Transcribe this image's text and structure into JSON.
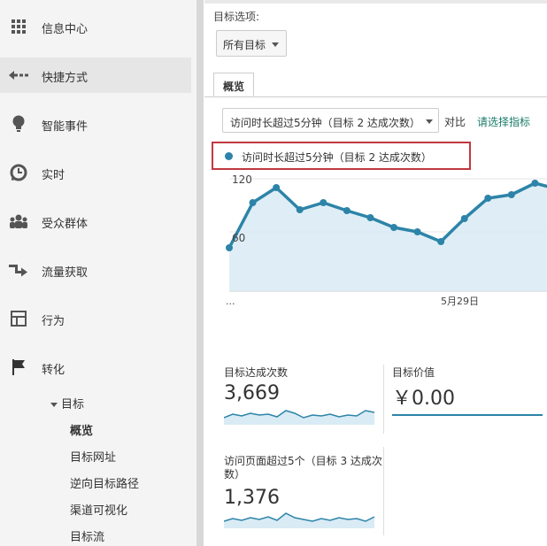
{
  "sidebar": {
    "items": [
      {
        "label": "信息中心",
        "icon": "grid-icon"
      },
      {
        "label": "快捷方式",
        "icon": "shortcut-arrow-icon"
      },
      {
        "label": "智能事件",
        "icon": "lightbulb-icon"
      },
      {
        "label": "实时",
        "icon": "clock-icon"
      },
      {
        "label": "受众群体",
        "icon": "people-icon"
      },
      {
        "label": "流量获取",
        "icon": "acquisition-icon"
      },
      {
        "label": "行为",
        "icon": "behavior-icon"
      },
      {
        "label": "转化",
        "icon": "flag-icon"
      }
    ],
    "sub_group_label": "目标",
    "sub_items": [
      "概览",
      "目标网址",
      "逆向目标路径",
      "渠道可视化",
      "目标流"
    ]
  },
  "main": {
    "goal_option_label": "目标选项:",
    "goal_select_value": "所有目标",
    "tab_overview": "概览",
    "metric_select_value": "访问时长超过5分钟（目标 2 达成次数）",
    "compare_label": "对比",
    "choose_metric_link": "请选择指标",
    "legend_label": "访问时长超过5分钟（目标 2 达成次数）",
    "accent_color": "#2d84a8"
  },
  "chart_data": {
    "type": "area",
    "series": [
      {
        "name": "访问时长超过5分钟（目标 2 达成次数）",
        "values": [
          42,
          93,
          110,
          85,
          93,
          84,
          76,
          65,
          60,
          49,
          75,
          98,
          102,
          115,
          108
        ]
      }
    ],
    "y_ticks": [
      120,
      60
    ],
    "ylim": [
      0,
      150
    ],
    "x_tick_labels": [
      "...",
      "5月29日"
    ],
    "grid": true
  },
  "scorecards": [
    {
      "title": "目标达成次数",
      "value": "3,669"
    },
    {
      "title": "目标价值",
      "value": "￥0.00"
    },
    {
      "title": "访问页面超过5个（目标 3 达成次数）",
      "value": "1,376"
    }
  ]
}
